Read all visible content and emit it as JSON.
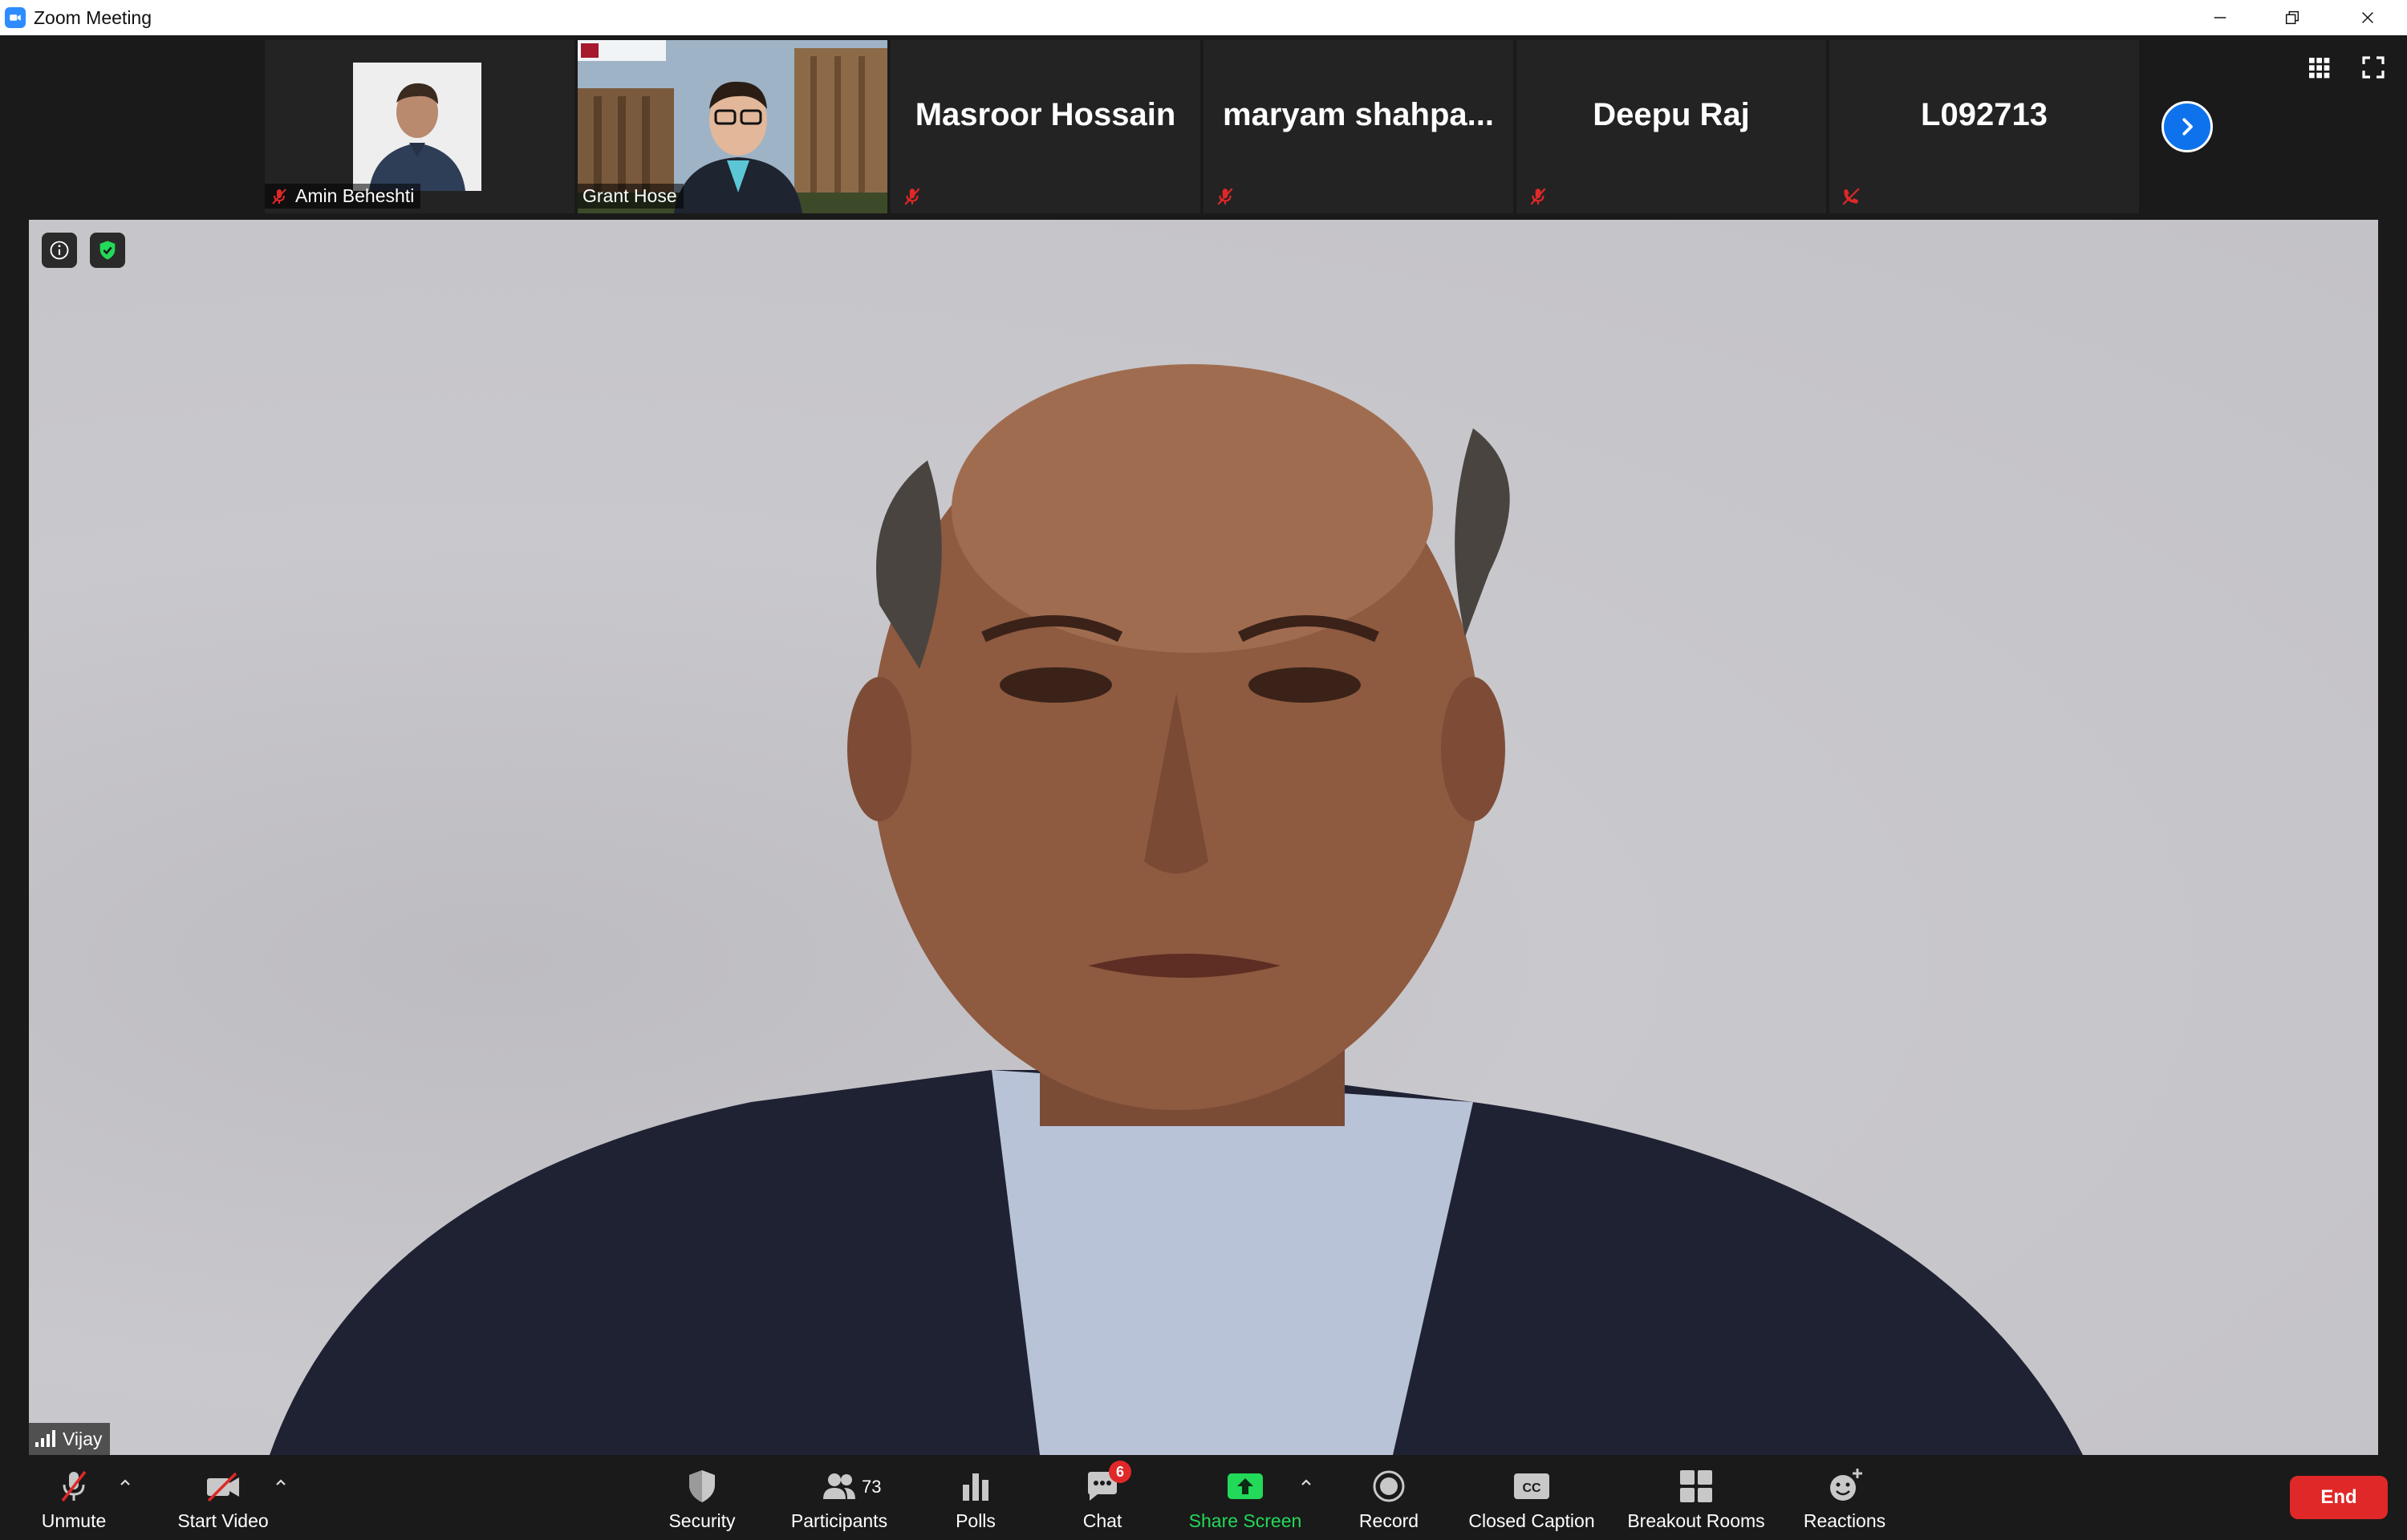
{
  "window": {
    "title": "Zoom Meeting"
  },
  "filmstrip": {
    "tiles": [
      {
        "name": "Amin Beheshti",
        "type": "photo",
        "muted": true
      },
      {
        "name": "Grant Hose",
        "type": "video",
        "muted": false
      },
      {
        "name": "Masroor Hossain",
        "type": "name",
        "muted": true
      },
      {
        "name": "maryam  shahpa...",
        "type": "name",
        "muted": true
      },
      {
        "name": "Deepu Raj",
        "type": "name",
        "muted": true
      },
      {
        "name": "L092713",
        "type": "name",
        "muted": true,
        "phone": true
      }
    ],
    "next_icon": "chevron-right-icon"
  },
  "main_video": {
    "speaker_name": "Vijay",
    "info_icon": "info-icon",
    "security_icon": "shield-check-icon",
    "signal_icon": "signal-bars-icon"
  },
  "toolbar": {
    "unmute_label": "Unmute",
    "start_video_label": "Start Video",
    "security_label": "Security",
    "participants_label": "Participants",
    "participants_count": "73",
    "polls_label": "Polls",
    "chat_label": "Chat",
    "chat_badge": "6",
    "share_screen_label": "Share Screen",
    "record_label": "Record",
    "closed_caption_label": "Closed Caption",
    "breakout_rooms_label": "Breakout Rooms",
    "reactions_label": "Reactions",
    "end_label": "End"
  },
  "colors": {
    "background": "#1a1a1a",
    "accent_blue": "#0e72ed",
    "share_green": "#23d959",
    "end_red": "#e02828",
    "muted_red": "#e02828"
  }
}
